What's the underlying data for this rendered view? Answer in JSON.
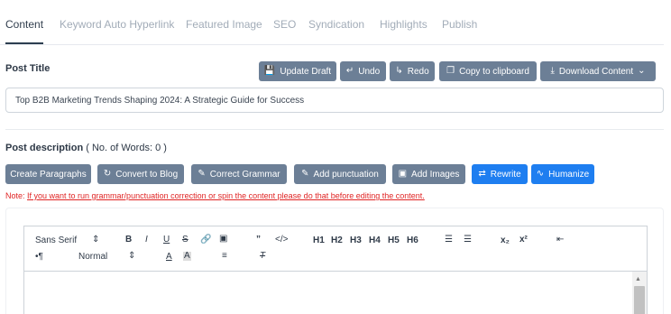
{
  "tabs": [
    "Content",
    "Keyword Auto Hyperlink",
    "Featured Image",
    "SEO",
    "Syndication",
    "Highlights",
    "Publish"
  ],
  "post_title": {
    "label": "Post Title",
    "value": "Top B2B Marketing Trends Shaping 2024: A Strategic Guide for Success"
  },
  "title_actions": {
    "update_draft": "Update Draft",
    "undo": "Undo",
    "redo": "Redo",
    "copy": "Copy to clipboard",
    "download": "Download Content"
  },
  "post_description": {
    "label": "Post description",
    "word_count": "( No. of Words: 0 )"
  },
  "content_actions": {
    "create_paragraphs": "Create Paragraphs",
    "convert_to_blog": "Convert to Blog",
    "correct_grammar": "Correct Grammar",
    "add_punctuation": "Add punctuation",
    "add_images": "Add Images",
    "rewrite": "Rewrite",
    "humanize": "Humanize"
  },
  "note": {
    "prefix": "Note: ",
    "text": "If you want to run grammar/punctuation correction or spin the content please do that before editing the content."
  },
  "editor_toolbar": {
    "font": "Sans Serif",
    "size": "Normal",
    "bold": "B",
    "italic": "I",
    "underline": "U",
    "strike": "S",
    "h1": "H1",
    "h2": "H2",
    "h3": "H3",
    "h4": "H4",
    "h5": "H5",
    "h6": "H6",
    "subscript": "x₂",
    "superscript": "x²"
  },
  "colors": {
    "gray_button": "#6c7f96",
    "blue_button": "#1e7ef0",
    "note_red": "#e02424"
  }
}
